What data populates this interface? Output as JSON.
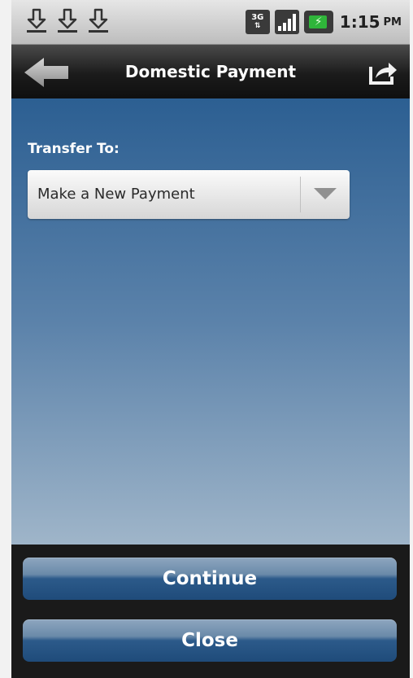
{
  "status_bar": {
    "icons": [
      "download-icon",
      "download-icon",
      "download-icon"
    ],
    "network_3g_label": "3G",
    "time": "1:15",
    "ampm": "PM"
  },
  "title_bar": {
    "title": "Domestic Payment"
  },
  "form": {
    "transfer_to_label": "Transfer To:",
    "transfer_to_value": "Make a New Payment"
  },
  "buttons": {
    "continue_label": "Continue",
    "close_label": "Close"
  },
  "colors": {
    "accent": "#2c5f92",
    "button": "#2c5a8a",
    "battery": "#2fb53a"
  }
}
